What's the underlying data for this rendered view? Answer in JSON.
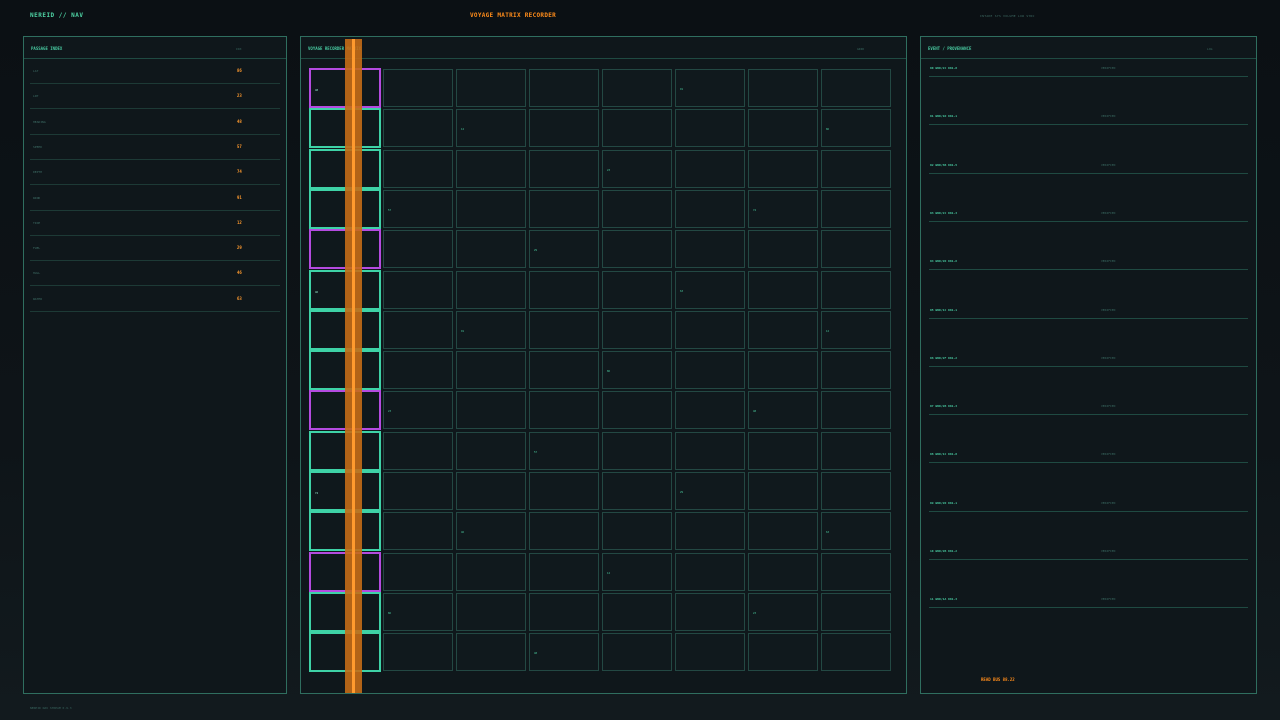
{
  "header": {
    "brand": "NEREID // NAV",
    "title": "VOYAGE MATRIX RECORDER",
    "status": "INTAKE SYS VOLUME LOW SYNC"
  },
  "left_panel": {
    "title": "PASSAGE INDEX",
    "aux": "IDX",
    "rows": [
      {
        "label": "LAT",
        "value": "86"
      },
      {
        "label": "LNT",
        "value": "23"
      },
      {
        "label": "HEADING",
        "value": "48"
      },
      {
        "label": "SPEED",
        "value": "57"
      },
      {
        "label": "DEPTH",
        "value": "74"
      },
      {
        "label": "WIND",
        "value": "91"
      },
      {
        "label": "TIDE",
        "value": "12"
      },
      {
        "label": "FUEL",
        "value": "29"
      },
      {
        "label": "HULL",
        "value": "46"
      },
      {
        "label": "WATER",
        "value": "63"
      }
    ]
  },
  "matrix_panel": {
    "title": "VOYAGE RECORDER MATRIX",
    "aux": "GRID",
    "col0_purple_rows": [
      0,
      4,
      8,
      12
    ],
    "markers": [
      {
        "row": 0,
        "col": 0,
        "v": "48"
      },
      {
        "row": 0,
        "col": 5,
        "v": "91"
      },
      {
        "row": 1,
        "col": 2,
        "v": "12"
      },
      {
        "row": 1,
        "col": 7,
        "v": "86"
      },
      {
        "row": 2,
        "col": 4,
        "v": "23"
      },
      {
        "row": 3,
        "col": 1,
        "v": "57"
      },
      {
        "row": 3,
        "col": 6,
        "v": "74"
      },
      {
        "row": 4,
        "col": 3,
        "v": "29"
      },
      {
        "row": 5,
        "col": 0,
        "v": "46"
      },
      {
        "row": 5,
        "col": 5,
        "v": "63"
      },
      {
        "row": 6,
        "col": 2,
        "v": "91"
      },
      {
        "row": 6,
        "col": 7,
        "v": "12"
      },
      {
        "row": 7,
        "col": 4,
        "v": "86"
      },
      {
        "row": 8,
        "col": 1,
        "v": "23"
      },
      {
        "row": 8,
        "col": 6,
        "v": "48"
      },
      {
        "row": 9,
        "col": 3,
        "v": "57"
      },
      {
        "row": 10,
        "col": 0,
        "v": "74"
      },
      {
        "row": 10,
        "col": 5,
        "v": "29"
      },
      {
        "row": 11,
        "col": 2,
        "v": "46"
      },
      {
        "row": 11,
        "col": 7,
        "v": "63"
      },
      {
        "row": 12,
        "col": 4,
        "v": "12"
      },
      {
        "row": 13,
        "col": 1,
        "v": "86"
      },
      {
        "row": 13,
        "col": 6,
        "v": "23"
      },
      {
        "row": 14,
        "col": 3,
        "v": "48"
      }
    ]
  },
  "events_panel": {
    "title": "EVENT / PROVENANCE",
    "aux": "LOG",
    "rows": [
      {
        "id": "00 WRD/2C 001-0",
        "tag": "VERIFIED"
      },
      {
        "id": "01 WRD/1D 001-1",
        "tag": "VERIFIED"
      },
      {
        "id": "02 WRD/3B 001-5",
        "tag": "VERIFIED"
      },
      {
        "id": "03 WRD/2C 001-3",
        "tag": "VERIFIED"
      },
      {
        "id": "04 WRD/2D 001-6",
        "tag": "VERIFIED"
      },
      {
        "id": "05 WRD/1C 001-1",
        "tag": "VERIFIED"
      },
      {
        "id": "06 WRD/2F 001-2",
        "tag": "VERIFIED"
      },
      {
        "id": "07 WRD/2B 001-3",
        "tag": "VERIFIED"
      },
      {
        "id": "08 WRD/1C 001-0",
        "tag": "VERIFIED"
      },
      {
        "id": "09 WRD/2D 001-1",
        "tag": "VERIFIED"
      },
      {
        "id": "10 WRD/2B 001-2",
        "tag": "VERIFIED"
      },
      {
        "id": "11 WRD/1A 001-3",
        "tag": "VERIFIED"
      }
    ],
    "readbus": "READ BUS 88.22"
  },
  "footer": {
    "text": "NEREID NAV STREAM 0.9.3"
  }
}
